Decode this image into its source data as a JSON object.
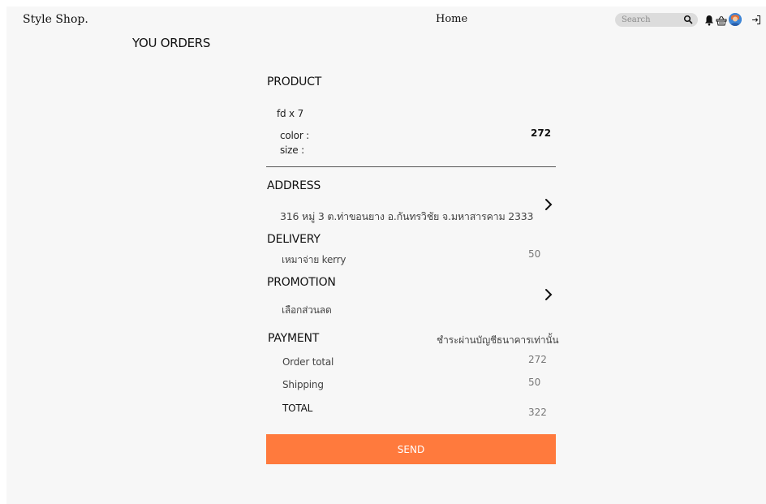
{
  "header": {
    "brand": "Style Shop.",
    "nav_home": "Home",
    "search_placeholder": "Search"
  },
  "page_title": "YOU ORDERS",
  "product": {
    "label": "PRODUCT",
    "item": "fd x 7",
    "color_label": "color :",
    "size_label": "size :",
    "price": "272"
  },
  "address": {
    "label": "ADDRESS",
    "value": "316  หมู่ 3 ต.ท่าขอนยาง อ.กันทรวิชัย จ.มหาสารคาม 2333"
  },
  "delivery": {
    "label": "DELIVERY",
    "method": "เหมาจ่าย  kerry",
    "cost": "50"
  },
  "promotion": {
    "label": "PROMOTION",
    "value": "เลือกส่วนลด"
  },
  "payment": {
    "label": "PAYMENT",
    "method": "ชำระผ่านบัญชีธนาคารเท่านั้น",
    "order_total_label": "Order total",
    "order_total": "272",
    "shipping_label": "Shipping",
    "shipping": "50",
    "total_label": "TOTAL",
    "total": "322"
  },
  "send_label": "SEND",
  "colors": {
    "accent": "#ff7a3d",
    "background": "#f7f7f7",
    "search_bg": "#dcdcdc"
  },
  "icons": [
    "search-icon",
    "bell-icon",
    "basket-icon",
    "avatar",
    "logout-icon",
    "chevron-right-icon"
  ]
}
